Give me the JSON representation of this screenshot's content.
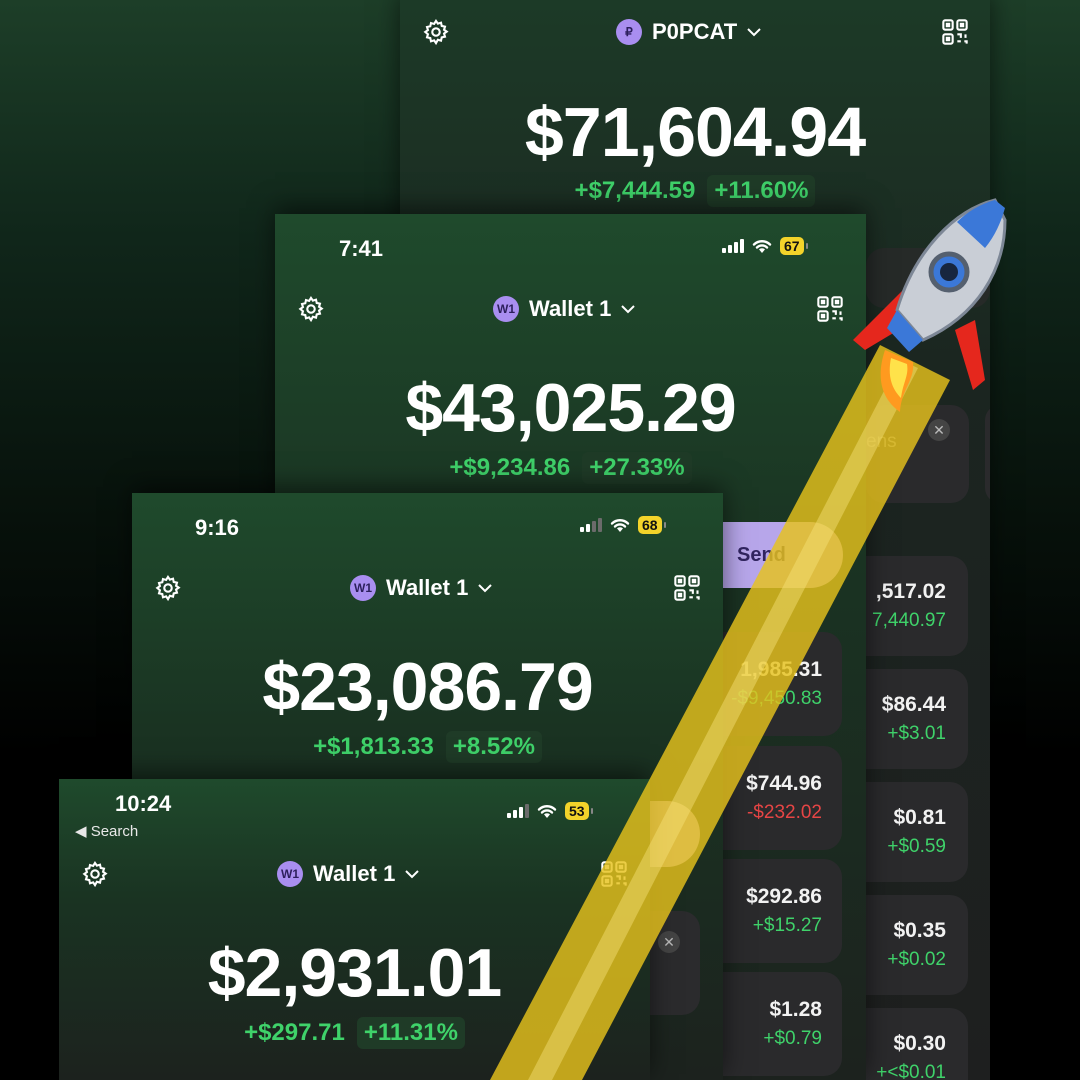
{
  "screens": [
    {
      "id": "s1",
      "token": {
        "avatar": "₽",
        "name": "P0PCAT"
      },
      "balance": "$71,604.94",
      "change": "+$7,444.59",
      "change_pct": "+11.60%",
      "cut_card_text": "ens",
      "rows": [
        {
          "value": ",517.02",
          "delta": "7,440.97",
          "dir": "up"
        },
        {
          "value": "$86.44",
          "delta": "+$3.01",
          "dir": "up"
        },
        {
          "value": "$0.81",
          "delta": "+$0.59",
          "dir": "up"
        },
        {
          "value": "$0.35",
          "delta": "+$0.02",
          "dir": "up"
        },
        {
          "value": "$0.30",
          "delta": "+<$0.01",
          "dir": "up"
        }
      ]
    },
    {
      "id": "s2",
      "status": {
        "time": "7:41",
        "battery": "67"
      },
      "wallet": {
        "avatar": "W1",
        "name": "Wallet 1"
      },
      "balance": "$43,025.29",
      "change": "+$9,234.86",
      "change_pct": "+27.33%",
      "send_label": "Send",
      "rows": [
        {
          "value": "1,985.31",
          "delta": "-$9,450.83",
          "dir": "down"
        },
        {
          "value": "$744.96",
          "delta": "-$232.02",
          "dir": "down"
        },
        {
          "value": "$292.86",
          "delta": "+$15.27",
          "dir": "up"
        },
        {
          "value": "$1.28",
          "delta": "+$0.79",
          "dir": "up"
        }
      ]
    },
    {
      "id": "s3",
      "status": {
        "time": "9:16",
        "battery": "68"
      },
      "wallet": {
        "avatar": "W1",
        "name": "Wallet 1"
      },
      "balance": "$23,086.79",
      "change": "+$1,813.33",
      "change_pct": "+8.52%"
    },
    {
      "id": "s4",
      "status": {
        "time": "10:24",
        "battery": "53",
        "back_label": "◀ Search"
      },
      "wallet": {
        "avatar": "W1",
        "name": "Wallet 1"
      },
      "balance": "$2,931.01",
      "change": "+$297.71",
      "change_pct": "+11.31%"
    }
  ],
  "colors": {
    "positive": "#3fd26a",
    "negative": "#e64545",
    "battery": "#f3d32a",
    "avatar": "#a98ef0",
    "beam": "#e6c21c"
  },
  "icons": {
    "settings": "gear-icon",
    "qr": "qr-code-icon",
    "rocket": "rocket-icon"
  }
}
